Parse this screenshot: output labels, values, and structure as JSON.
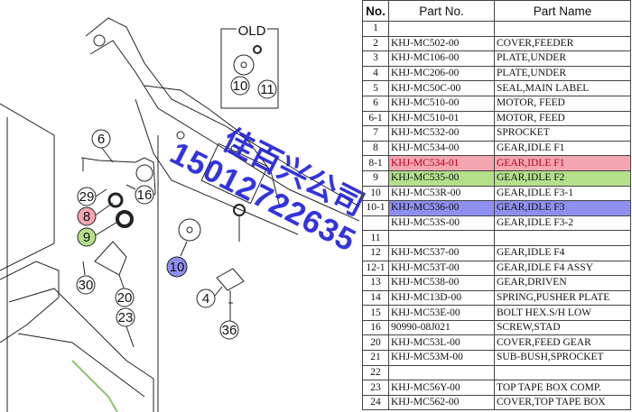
{
  "diagram": {
    "old_label": "OLD",
    "callouts": {
      "c6": "6",
      "c29": "29",
      "c8": "8",
      "c9": "9",
      "c16": "16",
      "c10_old": "10",
      "c11": "11",
      "c10": "10",
      "c30": "30",
      "c20": "20",
      "c23": "23",
      "c4": "4",
      "c36": "36"
    },
    "colors": {
      "pink": "#f4a6b0",
      "green": "#b4e08c",
      "blue": "#8f8ff0"
    }
  },
  "watermark": {
    "company": "佳百兴公司",
    "phone": "15012722635",
    "color": "#2222dd"
  },
  "table": {
    "headers": {
      "no": "No.",
      "part_no": "Part No.",
      "part_name": "Part Name"
    },
    "rows": [
      {
        "no": "1",
        "part_no": "",
        "part_name": ""
      },
      {
        "no": "2",
        "part_no": "KHJ-MC502-00",
        "part_name": "COVER,FEEDER"
      },
      {
        "no": "3",
        "part_no": "KHJ-MC106-00",
        "part_name": "PLATE,UNDER"
      },
      {
        "no": "4",
        "part_no": "KHJ-MC206-00",
        "part_name": "PLATE,UNDER"
      },
      {
        "no": "5",
        "part_no": "KHJ-MC50C-00",
        "part_name": "SEAL,MAIN LABEL"
      },
      {
        "no": "6",
        "part_no": "KHJ-MC510-00",
        "part_name": "MOTOR, FEED"
      },
      {
        "no": "6-1",
        "part_no": "KHJ-MC510-01",
        "part_name": "MOTOR, FEED"
      },
      {
        "no": "7",
        "part_no": "KHJ-MC532-00",
        "part_name": "SPROCKET"
      },
      {
        "no": "8",
        "part_no": "KHJ-MC534-00",
        "part_name": "GEAR,IDLE F1"
      },
      {
        "no": "8-1",
        "part_no": "KHJ-MC534-01",
        "part_name": "GEAR,IDLE F1",
        "highlight": "red"
      },
      {
        "no": "9",
        "part_no": "KHJ-MC535-00",
        "part_name": "GEAR,IDLE F2",
        "highlight": "green"
      },
      {
        "no": "10",
        "part_no": "KHJ-MC53R-00",
        "part_name": "GEAR,IDLE F3-1"
      },
      {
        "no": "10-1",
        "part_no": "KHJ-MC536-00",
        "part_name": "GEAR,IDLE F3",
        "highlight": "blue"
      },
      {
        "no": "",
        "part_no": "KHJ-MC53S-00",
        "part_name": "GEAR,IDLE F3-2"
      },
      {
        "no": "11",
        "part_no": "",
        "part_name": ""
      },
      {
        "no": "12",
        "part_no": "KHJ-MC537-00",
        "part_name": "GEAR,IDLE F4"
      },
      {
        "no": "12-1",
        "part_no": "KHJ-MC53T-00",
        "part_name": "GEAR,IDLE F4 ASSY"
      },
      {
        "no": "13",
        "part_no": "KHJ-MC538-00",
        "part_name": "GEAR,DRIVEN"
      },
      {
        "no": "14",
        "part_no": "KHJ-MC13D-00",
        "part_name": "SPRING,PUSHER PLATE"
      },
      {
        "no": "15",
        "part_no": "KHJ-MC53E-00",
        "part_name": "BOLT HEX.S/H LOW"
      },
      {
        "no": "16",
        "part_no": "90990-08J021",
        "part_name": "SCREW,STAD"
      },
      {
        "no": "20",
        "part_no": "KHJ-MC53L-00",
        "part_name": "COVER,FEED GEAR"
      },
      {
        "no": "21",
        "part_no": "KHJ-MC53M-00",
        "part_name": "SUB-BUSH,SPROCKET"
      },
      {
        "no": "22",
        "part_no": "",
        "part_name": ""
      },
      {
        "no": "23",
        "part_no": "KHJ-MC56Y-00",
        "part_name": "TOP TAPE BOX COMP."
      },
      {
        "no": "24",
        "part_no": "KHJ-MC562-00",
        "part_name": "COVER,TOP TAPE BOX"
      }
    ]
  }
}
